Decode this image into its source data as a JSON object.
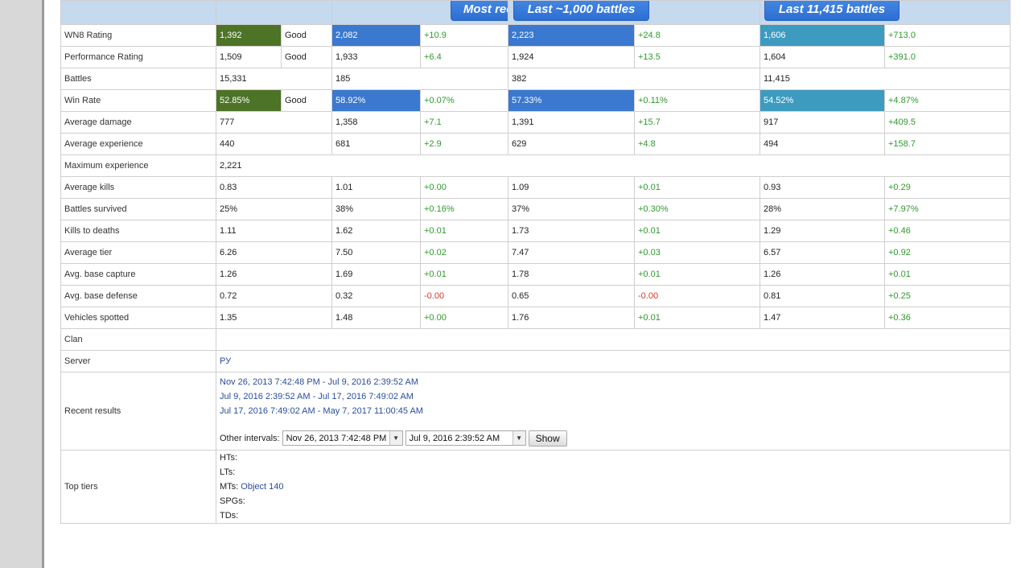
{
  "headers": {
    "recent": "Most recent",
    "last1000": "Last ~1,000 battles",
    "all": "Last 11,415 battles"
  },
  "rows": {
    "wn8": {
      "label": "WN8 Rating",
      "overall": "1,392",
      "rating": "Good",
      "recent": "2,082",
      "recent_delta": "+10.9",
      "last1000": "2,223",
      "last1000_delta": "+24.8",
      "all": "1,606",
      "all_delta": "+713.0"
    },
    "perf": {
      "label": "Performance Rating",
      "overall": "1,509",
      "rating": "Good",
      "recent": "1,933",
      "recent_delta": "+6.4",
      "last1000": "1,924",
      "last1000_delta": "+13.5",
      "all": "1,604",
      "all_delta": "+391.0"
    },
    "battles": {
      "label": "Battles",
      "overall": "15,331",
      "recent": "185",
      "last1000": "382",
      "all": "11,415"
    },
    "winrate": {
      "label": "Win Rate",
      "overall": "52.85%",
      "rating": "Good",
      "recent": "58.92%",
      "recent_delta": "+0.07%",
      "last1000": "57.33%",
      "last1000_delta": "+0.11%",
      "all": "54.52%",
      "all_delta": "+4.87%"
    },
    "avg_damage": {
      "label": "Average damage",
      "overall": "777",
      "recent": "1,358",
      "recent_delta": "+7.1",
      "last1000": "1,391",
      "last1000_delta": "+15.7",
      "all": "917",
      "all_delta": "+409.5"
    },
    "avg_exp": {
      "label": "Average experience",
      "overall": "440",
      "recent": "681",
      "recent_delta": "+2.9",
      "last1000": "629",
      "last1000_delta": "+4.8",
      "all": "494",
      "all_delta": "+158.7"
    },
    "max_exp": {
      "label": "Maximum experience",
      "overall": "2,221"
    },
    "avg_kills": {
      "label": "Average kills",
      "overall": "0.83",
      "recent": "1.01",
      "recent_delta": "+0.00",
      "last1000": "1.09",
      "last1000_delta": "+0.01",
      "all": "0.93",
      "all_delta": "+0.29"
    },
    "survived": {
      "label": "Battles survived",
      "overall": "25%",
      "recent": "38%",
      "recent_delta": "+0.16%",
      "last1000": "37%",
      "last1000_delta": "+0.30%",
      "all": "28%",
      "all_delta": "+7.97%"
    },
    "kd": {
      "label": "Kills to deaths",
      "overall": "1.11",
      "recent": "1.62",
      "recent_delta": "+0.01",
      "last1000": "1.73",
      "last1000_delta": "+0.01",
      "all": "1.29",
      "all_delta": "+0.46"
    },
    "avg_tier": {
      "label": "Average tier",
      "overall": "6.26",
      "recent": "7.50",
      "recent_delta": "+0.02",
      "last1000": "7.47",
      "last1000_delta": "+0.03",
      "all": "6.57",
      "all_delta": "+0.92"
    },
    "capture": {
      "label": "Avg. base capture",
      "overall": "1.26",
      "recent": "1.69",
      "recent_delta": "+0.01",
      "last1000": "1.78",
      "last1000_delta": "+0.01",
      "all": "1.26",
      "all_delta": "+0.01"
    },
    "defense": {
      "label": "Avg. base defense",
      "overall": "0.72",
      "recent": "0.32",
      "recent_delta": "-0.00",
      "last1000": "0.65",
      "last1000_delta": "-0.00",
      "all": "0.81",
      "all_delta": "+0.25"
    },
    "spotted": {
      "label": "Vehicles spotted",
      "overall": "1.35",
      "recent": "1.48",
      "recent_delta": "+0.00",
      "last1000": "1.76",
      "last1000_delta": "+0.01",
      "all": "1.47",
      "all_delta": "+0.36"
    },
    "clan": {
      "label": "Clan",
      "value": ""
    },
    "server": {
      "label": "Server",
      "value": "РУ"
    }
  },
  "recent_results": {
    "label": "Recent results",
    "links": [
      "Nov 26, 2013 7:42:48 PM - Jul 9, 2016 2:39:52 AM",
      "Jul 9, 2016 2:39:52 AM - Jul 17, 2016 7:49:02 AM",
      "Jul 17, 2016 7:49:02 AM - May 7, 2017 11:00:45 AM"
    ],
    "other_intervals_label": "Other intervals:",
    "from_value": "Nov 26, 2013 7:42:48 PM",
    "to_value": "Jul 9, 2016 2:39:52 AM",
    "show_label": "Show"
  },
  "top_tiers": {
    "label": "Top tiers",
    "hts_label": "HTs:",
    "lts_label": "LTs:",
    "mts_label": "MTs:",
    "mts_value": "Object 140",
    "spgs_label": "SPGs:",
    "tds_label": "TDs:"
  },
  "colors": {
    "good_green": "#4c7326",
    "blue": "#3b78cf",
    "teal": "#3d9bc0",
    "positive": "#2e9a2e",
    "negative": "#d03a2a"
  }
}
